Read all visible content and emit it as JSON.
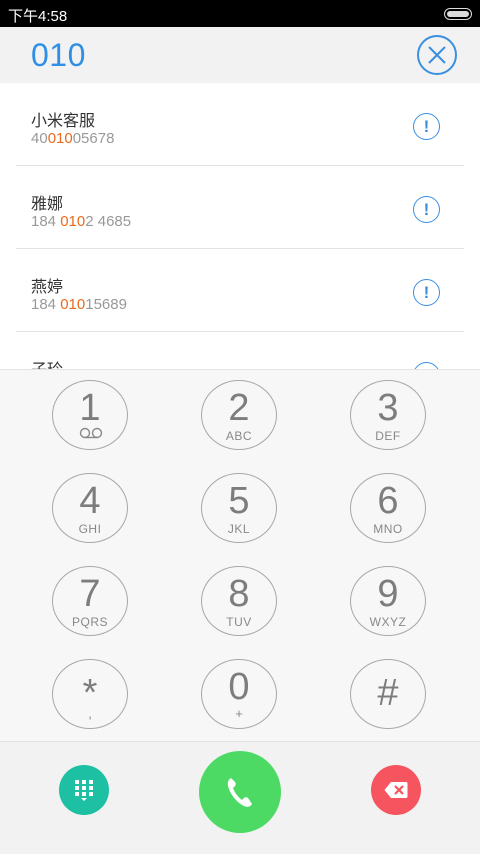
{
  "status_bar": {
    "time": "下午4:58"
  },
  "dialer": {
    "typed_number": "010"
  },
  "contacts": [
    {
      "name": "小米客服",
      "num_pre": "40",
      "num_match": "010",
      "num_post": "05678"
    },
    {
      "name": "雅娜",
      "num_pre": "184 ",
      "num_match": "010",
      "num_post": "2 4685"
    },
    {
      "name": "燕婷",
      "num_pre": "184 ",
      "num_match": "010",
      "num_post": "15689"
    },
    {
      "name": "子玲",
      "num_pre": "",
      "num_match": "",
      "num_post": ""
    }
  ],
  "info_glyph": "!",
  "keypad": [
    {
      "digit": "1",
      "letters": ""
    },
    {
      "digit": "2",
      "letters": "ABC"
    },
    {
      "digit": "3",
      "letters": "DEF"
    },
    {
      "digit": "4",
      "letters": "GHI"
    },
    {
      "digit": "5",
      "letters": "JKL"
    },
    {
      "digit": "6",
      "letters": "MNO"
    },
    {
      "digit": "7",
      "letters": "PQRS"
    },
    {
      "digit": "8",
      "letters": "TUV"
    },
    {
      "digit": "9",
      "letters": "WXYZ"
    },
    {
      "digit": "*",
      "letters": ","
    },
    {
      "digit": "0",
      "letters": "+"
    },
    {
      "digit": "#",
      "letters": ""
    }
  ],
  "colors": {
    "accent_blue": "#2f8fe5",
    "match_orange": "#e96b1d",
    "call_green": "#4cd964",
    "dialpad_teal": "#1ec0a4",
    "delete_red": "#f6545e"
  },
  "icons": {
    "clear": "close-icon",
    "info": "info-icon",
    "voicemail": "voicemail-icon",
    "dialpad": "dialpad-icon",
    "call": "phone-icon",
    "delete": "backspace-icon"
  }
}
